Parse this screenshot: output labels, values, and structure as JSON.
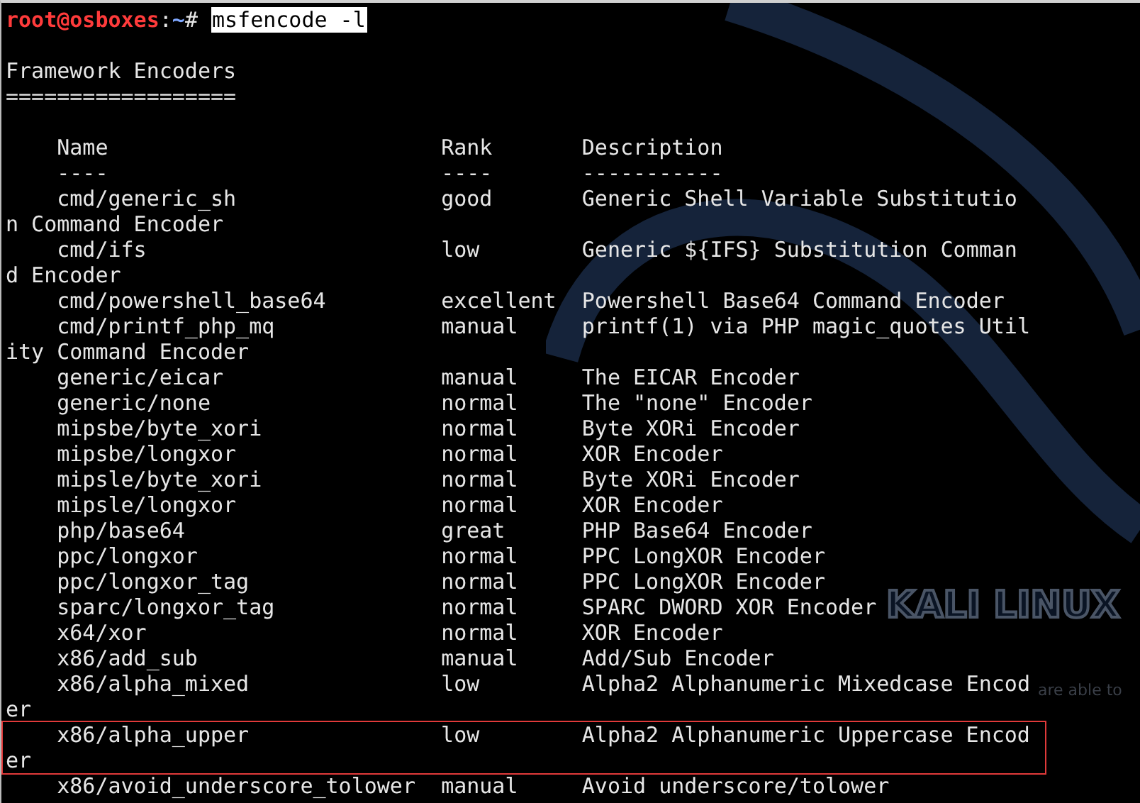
{
  "prompt": {
    "user_host": "root@osboxes",
    "separator": ":",
    "path": "~",
    "symbol": "#",
    "command": {
      "text": "msfencode -l",
      "selected": true
    }
  },
  "heading": "Framework Encoders",
  "heading_rule": "==================",
  "columns": [
    {
      "label": "Name",
      "rule": "----"
    },
    {
      "label": "Rank",
      "rule": "----"
    },
    {
      "label": "Description",
      "rule": "-----------"
    }
  ],
  "encoders": [
    {
      "name": "cmd/generic_sh",
      "rank": "good",
      "description": "Generic Shell Variable Substitution Command Encoder",
      "boxed": false
    },
    {
      "name": "cmd/ifs",
      "rank": "low",
      "description": "Generic ${IFS} Substitution Command Encoder",
      "boxed": false
    },
    {
      "name": "cmd/powershell_base64",
      "rank": "excellent",
      "description": "Powershell Base64 Command Encoder",
      "boxed": false
    },
    {
      "name": "cmd/printf_php_mq",
      "rank": "manual",
      "description": "printf(1) via PHP magic_quotes Utility Command Encoder",
      "boxed": false
    },
    {
      "name": "generic/eicar",
      "rank": "manual",
      "description": "The EICAR Encoder",
      "boxed": false
    },
    {
      "name": "generic/none",
      "rank": "normal",
      "description": "The \"none\" Encoder",
      "boxed": false
    },
    {
      "name": "mipsbe/byte_xori",
      "rank": "normal",
      "description": "Byte XORi Encoder",
      "boxed": false
    },
    {
      "name": "mipsbe/longxor",
      "rank": "normal",
      "description": "XOR Encoder",
      "boxed": false
    },
    {
      "name": "mipsle/byte_xori",
      "rank": "normal",
      "description": "Byte XORi Encoder",
      "boxed": false
    },
    {
      "name": "mipsle/longxor",
      "rank": "normal",
      "description": "XOR Encoder",
      "boxed": false
    },
    {
      "name": "php/base64",
      "rank": "great",
      "description": "PHP Base64 Encoder",
      "boxed": false
    },
    {
      "name": "ppc/longxor",
      "rank": "normal",
      "description": "PPC LongXOR Encoder",
      "boxed": false
    },
    {
      "name": "ppc/longxor_tag",
      "rank": "normal",
      "description": "PPC LongXOR Encoder",
      "boxed": false
    },
    {
      "name": "sparc/longxor_tag",
      "rank": "normal",
      "description": "SPARC DWORD XOR Encoder",
      "boxed": false
    },
    {
      "name": "x64/xor",
      "rank": "normal",
      "description": "XOR Encoder",
      "boxed": false
    },
    {
      "name": "x86/add_sub",
      "rank": "manual",
      "description": "Add/Sub Encoder",
      "boxed": false
    },
    {
      "name": "x86/alpha_mixed",
      "rank": "low",
      "description": "Alpha2 Alphanumeric Mixedcase Encoder",
      "boxed": false
    },
    {
      "name": "x86/alpha_upper",
      "rank": "low",
      "description": "Alpha2 Alphanumeric Uppercase Encoder",
      "boxed": true
    },
    {
      "name": "x86/avoid_underscore_tolower",
      "rank": "manual",
      "description": "Avoid underscore/tolower",
      "boxed": false
    }
  ],
  "wallpaper": {
    "logo": "KALI LINUX",
    "tagline": "are able to"
  }
}
